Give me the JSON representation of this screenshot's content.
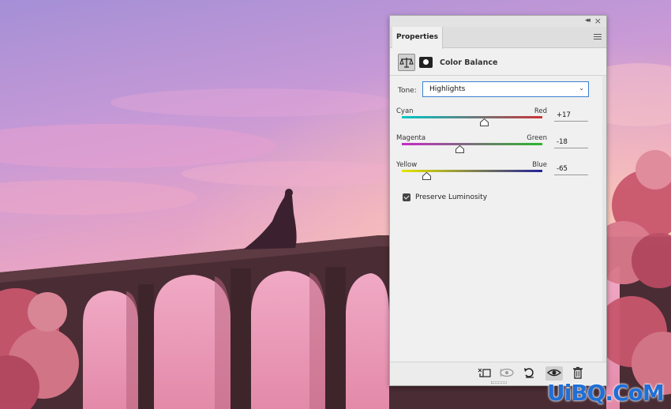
{
  "panel": {
    "tab_label": "Properties",
    "adjustment_title": "Color Balance",
    "tone_label": "Tone:",
    "tone_value": "Highlights",
    "sliders": [
      {
        "left_label": "Cyan",
        "right_label": "Red",
        "value_text": "+17",
        "value": 17
      },
      {
        "left_label": "Magenta",
        "right_label": "Green",
        "value_text": "-18",
        "value": -18
      },
      {
        "left_label": "Yellow",
        "right_label": "Blue",
        "value_text": "-65",
        "value": -65
      }
    ],
    "preserve_luminosity_label": "Preserve Luminosity",
    "preserve_luminosity_checked": true
  },
  "watermark": {
    "text": "UiBQ.CoM"
  },
  "icons": {
    "collapse": "double-chevron-left-icon",
    "close": "close-icon",
    "menu": "hamburger-menu-icon",
    "adjustment": "color-balance-scale-icon",
    "mask": "layer-mask-icon",
    "clip": "clip-to-layer-icon",
    "view_previous": "view-previous-state-icon",
    "reset": "reset-icon",
    "visibility": "eye-icon",
    "delete": "trash-icon"
  },
  "colors": {
    "panel_bg": "#f0f0f0",
    "accent_border": "#3b7fd0",
    "watermark": "#1f6fd6"
  }
}
